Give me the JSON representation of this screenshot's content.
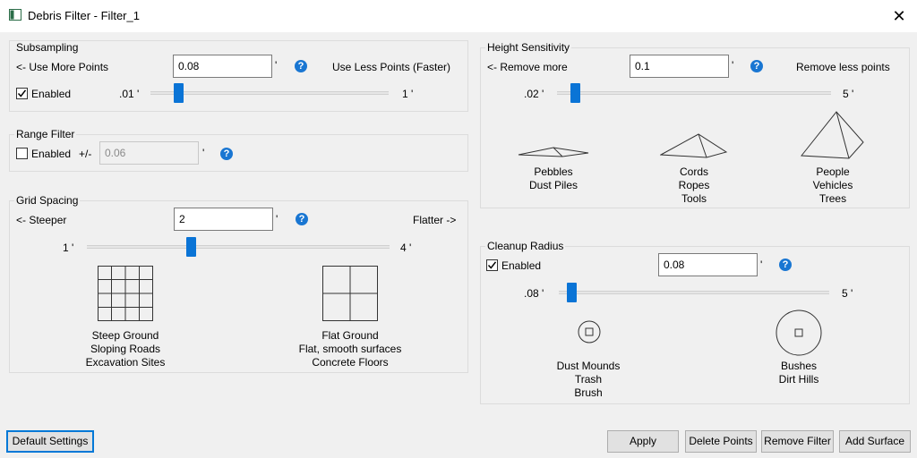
{
  "window": {
    "title": "Debris Filter - Filter_1",
    "close_glyph": "✕",
    "app_icon": "app-window-icon"
  },
  "subsampling": {
    "title": "Subsampling",
    "left_hint": "<- Use More Points",
    "right_hint": "Use Less Points (Faster)",
    "value": "0.08",
    "unit": "'",
    "enabled_label": "Enabled",
    "enabled": true,
    "min_label": ".01 '",
    "max_label": "1 '",
    "slider_fraction": 0.07
  },
  "range_filter": {
    "title": "Range Filter",
    "enabled_label": "Enabled",
    "enabled": false,
    "plusminus": "+/-",
    "value": "0.06",
    "unit": "'"
  },
  "grid_spacing": {
    "title": "Grid Spacing",
    "left_hint": "<- Steeper",
    "right_hint": "Flatter ->",
    "value": "2",
    "unit": "'",
    "min_label": "1 '",
    "max_label": "4 '",
    "slider_fraction": 0.33,
    "steep_lines": [
      "Steep Ground",
      "Sloping Roads",
      "Excavation Sites"
    ],
    "flat_lines": [
      "Flat Ground",
      "Flat, smooth surfaces",
      "Concrete Floors"
    ]
  },
  "height_sensitivity": {
    "title": "Height Sensitivity",
    "left_hint": "<- Remove more",
    "right_hint": "Remove less points",
    "value": "0.1",
    "unit": "'",
    "min_label": ".02 '",
    "max_label": "5 '",
    "slider_fraction": 0.02,
    "low_lines": [
      "Pebbles",
      "Dust Piles"
    ],
    "mid_lines": [
      "Cords",
      "Ropes",
      "Tools"
    ],
    "high_lines": [
      "People",
      "Vehicles",
      "Trees"
    ]
  },
  "cleanup_radius": {
    "title": "Cleanup Radius",
    "enabled_label": "Enabled",
    "enabled": true,
    "value": "0.08",
    "unit": "'",
    "min_label": ".08 '",
    "max_label": "5 '",
    "slider_fraction": 0.0,
    "small_lines": [
      "Dust Mounds",
      "Trash",
      "Brush"
    ],
    "large_lines": [
      "Bushes",
      "Dirt Hills"
    ]
  },
  "buttons": {
    "default_settings": "Default Settings",
    "apply": "Apply",
    "delete_points": "Delete Points",
    "remove_filter": "Remove Filter",
    "add_surface": "Add Surface"
  },
  "help_glyph": "?"
}
